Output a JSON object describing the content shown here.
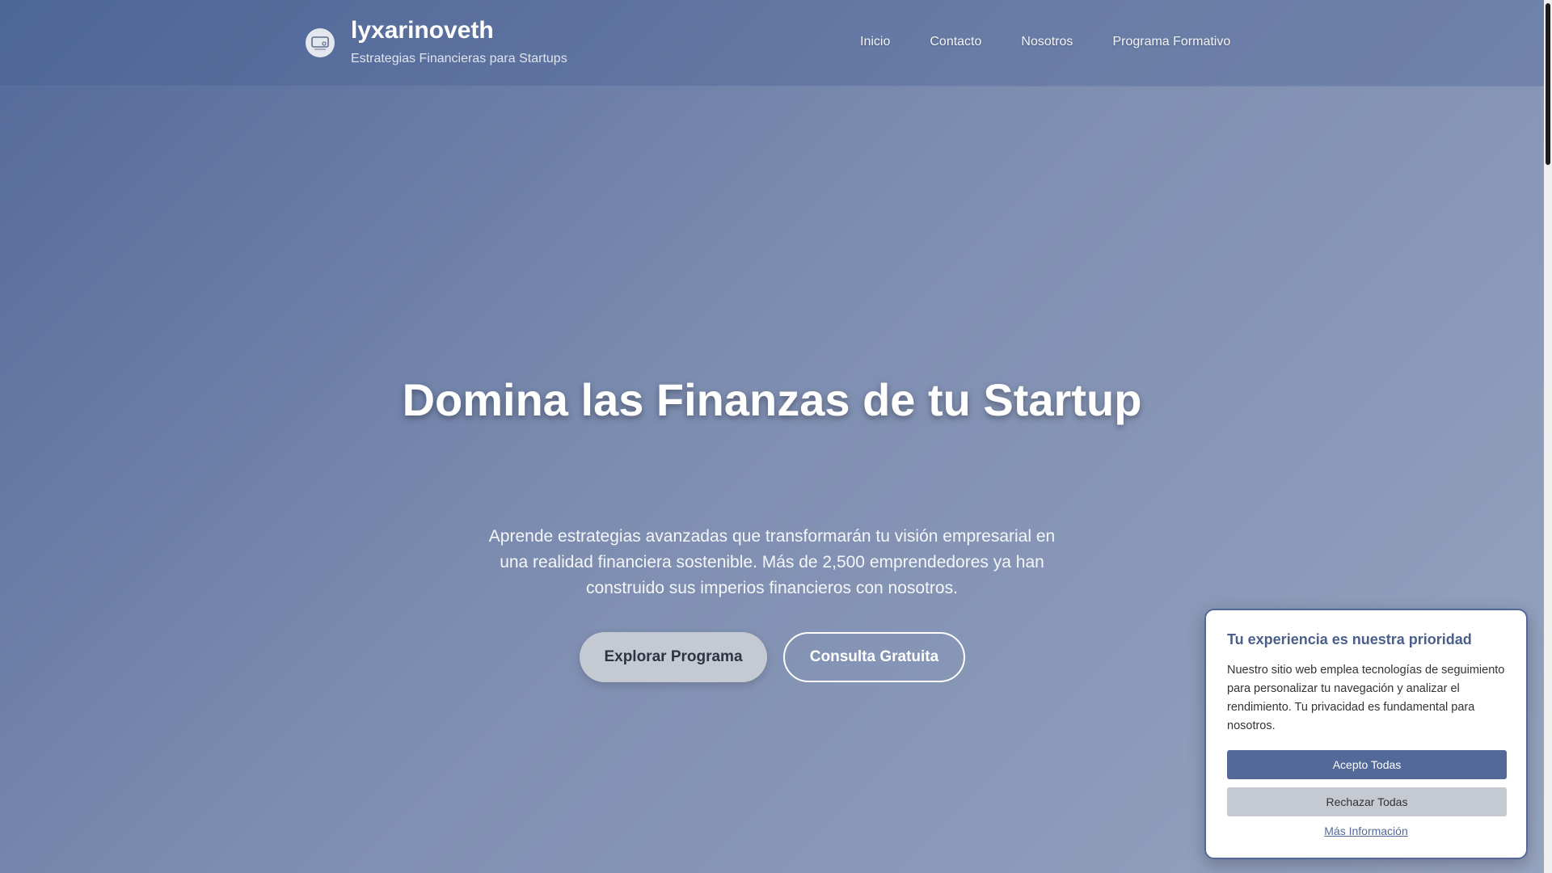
{
  "header": {
    "brand_title": "lyxarinoveth",
    "tagline": "Estrategias Financieras para Startups",
    "logo_icon": "wallet-icon",
    "nav": [
      "Inicio",
      "Contacto",
      "Nosotros",
      "Programa Formativo"
    ]
  },
  "hero": {
    "title": "Domina las Finanzas de tu Startup",
    "subtitle": "Aprende estrategias avanzadas que transformarán tu visión empresarial en una realidad financiera sostenible. Más de 2,500 emprendedores ya han construido sus imperios financieros con nosotros.",
    "primary_button": "Explorar Programa",
    "secondary_button": "Consulta Gratuita"
  },
  "cookie_banner": {
    "title": "Tu experiencia es nuestra prioridad",
    "text": "Nuestro sitio web emplea tecnologías de seguimiento para personalizar tu navegación y analizar el rendimiento. Tu privacidad es fundamental para nosotros.",
    "accept": "Acepto Todas",
    "reject": "Rechazar Todas",
    "more": "Más Información"
  },
  "colors": {
    "accent": "#53699a",
    "primary_button_bg": "#c5c9d2"
  }
}
